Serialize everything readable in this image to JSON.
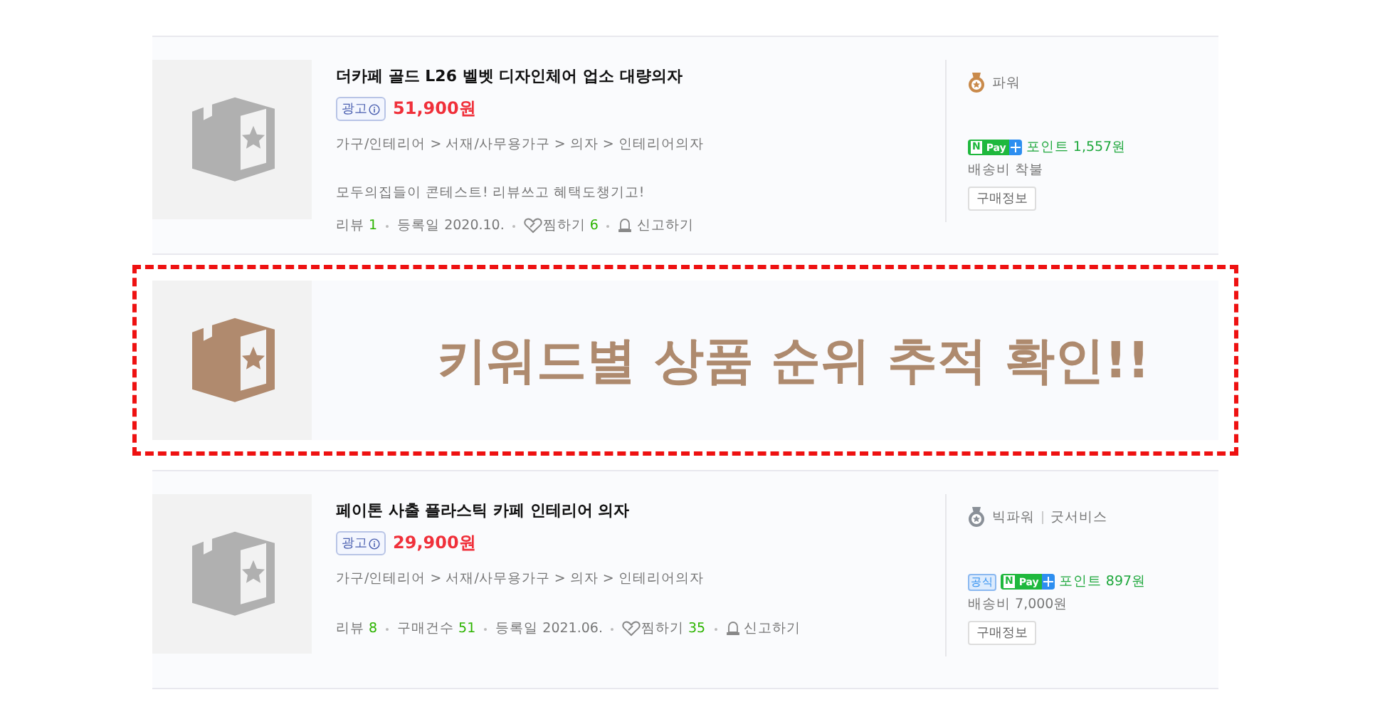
{
  "items": [
    {
      "kind": "product",
      "title": "더카페 골드 L26 벨벳 디자인체어 업소 대량의자",
      "ad_badge": "광고",
      "price": "51,900원",
      "categories": "가구/인테리어 > 서재/사무용가구 > 의자 > 인테리어의자",
      "description": "모두의집들이 콘테스트! 리뷰쓰고 혜택도챙기고!",
      "stats": [
        {
          "kind": "plain",
          "label": "리뷰",
          "value": "1"
        },
        {
          "kind": "plain",
          "label": "등록일 2020.10."
        },
        {
          "kind": "wish",
          "label": "찜하기",
          "value": "6"
        },
        {
          "kind": "report",
          "label": "신고하기"
        }
      ],
      "color": "#c98a4b",
      "grades": [
        "파워"
      ],
      "official": false,
      "npay": {
        "n": "N",
        "pay": "Pay"
      },
      "points": "포인트 1,557원",
      "shipping": "배송비 착불",
      "info_button": "구매정보"
    },
    {
      "kind": "banner",
      "text": "키워드별 상품 순위 추적 확인!!"
    },
    {
      "kind": "product",
      "title": "페이톤 사출 플라스틱 카페 인테리어 의자",
      "ad_badge": "광고",
      "price": "29,900원",
      "categories": "가구/인테리어 > 서재/사무용가구 > 의자 > 인테리어의자",
      "stats": [
        {
          "kind": "plain",
          "label": "리뷰",
          "value": "8"
        },
        {
          "kind": "plain",
          "label": "구매건수",
          "value": "51"
        },
        {
          "kind": "plain",
          "label": "등록일 2021.06."
        },
        {
          "kind": "wish",
          "label": "찜하기",
          "value": "35"
        },
        {
          "kind": "report",
          "label": "신고하기"
        }
      ],
      "color": "#8a9098",
      "grades": [
        "빅파워",
        "굿서비스"
      ],
      "official": true,
      "official_label": "공식",
      "npay": {
        "n": "N",
        "pay": "Pay"
      },
      "points": "포인트 897원",
      "shipping": "배송비 7,000원",
      "info_button": "구매정보"
    }
  ]
}
